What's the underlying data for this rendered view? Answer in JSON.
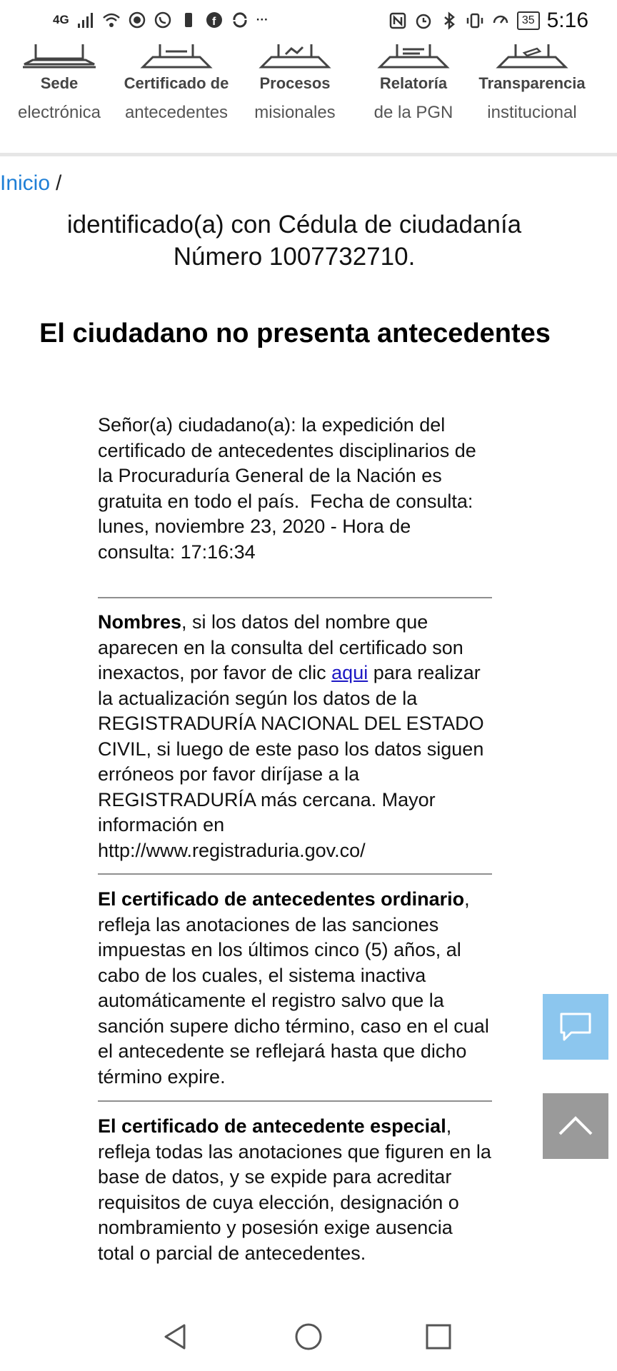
{
  "status_bar": {
    "network": "4G",
    "battery": "35",
    "time": "5:16"
  },
  "top_nav": {
    "items": [
      {
        "line1": "Sede",
        "line2": "electrónica",
        "icon": "laptop-icon"
      },
      {
        "line1": "Certificado de",
        "line2": "antecedentes",
        "icon": "certificate-tray-icon"
      },
      {
        "line1": "Procesos",
        "line2": "misionales",
        "icon": "document-image-icon"
      },
      {
        "line1": "Relatoría",
        "line2": "de la PGN",
        "icon": "document-lines-icon"
      },
      {
        "line1": "Transparencia",
        "line2": "institucional",
        "icon": "document-pen-icon"
      }
    ]
  },
  "breadcrumb": {
    "home": "Inicio",
    "separator": "/"
  },
  "identity": {
    "line1": "identificado(a) con Cédula de ciudadanía",
    "line2": "Número 1007732710."
  },
  "result_title": "El ciudadano no presenta antecedentes",
  "notice": {
    "text": "Señor(a) ciudadano(a): la expedición del certificado de antecedentes disciplinarios de la Procuraduría General de la Nación es gratuita en todo el país.",
    "query_date": "Fecha de consulta: lunes, noviembre 23, 2020 - Hora de consulta: 17:16:34"
  },
  "names_section": {
    "bold": "Nombres",
    "text_before_link": ", si los datos del nombre que aparecen en la consulta del certificado son inexactos, por favor de clic ",
    "link": "aqui",
    "text_after_link": " para realizar la actualización según los datos de la REGISTRADURÍA NACIONAL DEL ESTADO CIVIL, si luego de este paso los datos siguen erróneos por favor diríjase a la REGISTRADURÍA más cercana. Mayor información en http://www.registraduria.gov.co/"
  },
  "ordinary_section": {
    "bold": "El certificado de antecedentes ordinario",
    "text": ", refleja las anotaciones de las sanciones impuestas en los últimos cinco (5) años, al cabo de los cuales, el sistema inactiva automáticamente el registro salvo que la sanción supere dicho término, caso en el cual el antecedente se reflejará hasta que dicho término expire."
  },
  "special_section": {
    "bold": "El certificado de antecedente especial",
    "text": ", refleja todas las anotaciones que figuren en la base de datos, y se expide para acreditar requisitos de cuya elección, designación o nombramiento y posesión exige ausencia total o parcial de antecedentes."
  },
  "colors": {
    "link": "#1f7fd6",
    "chat_button": "#8cc6ee",
    "scroll_top_button": "#9a9a9a"
  }
}
